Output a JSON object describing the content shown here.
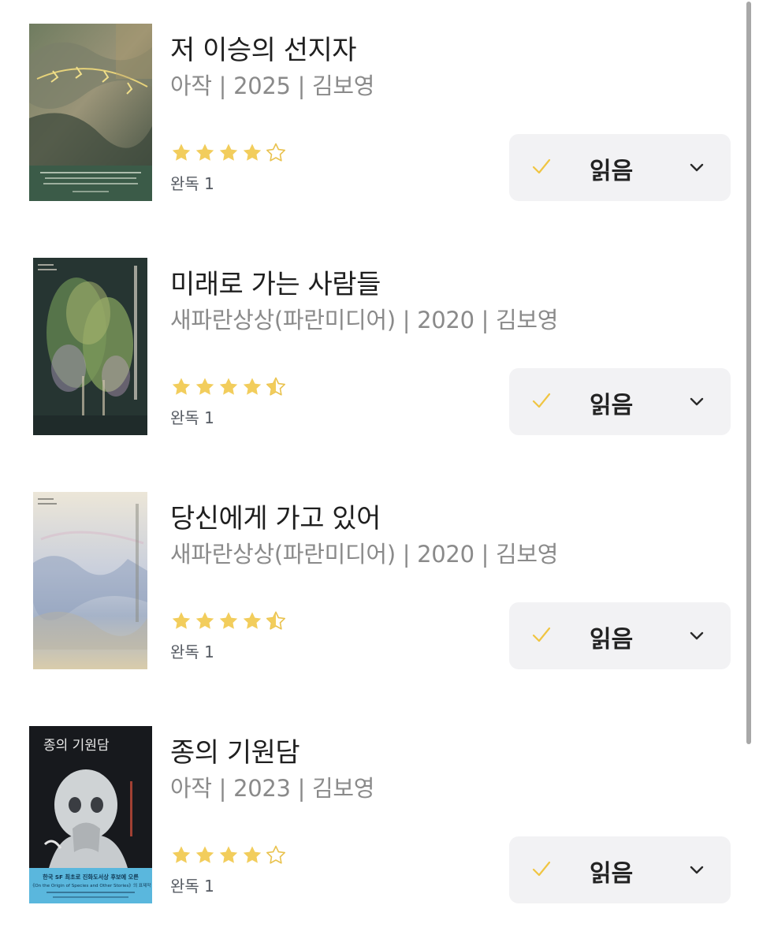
{
  "books": [
    {
      "title": "저 이승의 선지자",
      "meta": "아작 | 2025 | 김보영",
      "rating": 4,
      "read_count": "완독 1",
      "status": "읽음",
      "cover": {
        "palette": [
          "#8b8a6c",
          "#3f5a4a",
          "#c9b86a"
        ],
        "blurb_color": "#3b5b48"
      }
    },
    {
      "title": "미래로 가는 사람들",
      "meta": "새파란상상(파란미디어) | 2020 | 김보영",
      "rating": 4.5,
      "read_count": "완독 1",
      "status": "읽음",
      "cover": {
        "palette": [
          "#2b3b3a",
          "#6e8a55",
          "#b7a4c6"
        ]
      }
    },
    {
      "title": "당신에게 가고 있어",
      "meta": "새파란상상(파란미디어) | 2020 | 김보영",
      "rating": 4.5,
      "read_count": "완독 1",
      "status": "읽음",
      "cover": {
        "palette": [
          "#e6e0d2",
          "#a9b6c9",
          "#d8c9a7"
        ]
      }
    },
    {
      "title": "종의 기원담",
      "meta": "아작 | 2023 | 김보영",
      "rating": 4,
      "read_count": "완독 1",
      "status": "읽음",
      "cover": {
        "palette": [
          "#1a1c20",
          "#d9dbdc",
          "#56b6dc"
        ],
        "cover_title": "종의 기원담",
        "blurb": "한국 SF 최초로 진화도서상 후보에 오른",
        "blurb2": "《On the Origin of Species and Other Stories》의 표제작"
      }
    }
  ],
  "colors": {
    "star_fill": "#f2cd5c",
    "star_outline": "#e9c24e",
    "check": "#f0c542",
    "button_bg": "#f2f2f4"
  }
}
